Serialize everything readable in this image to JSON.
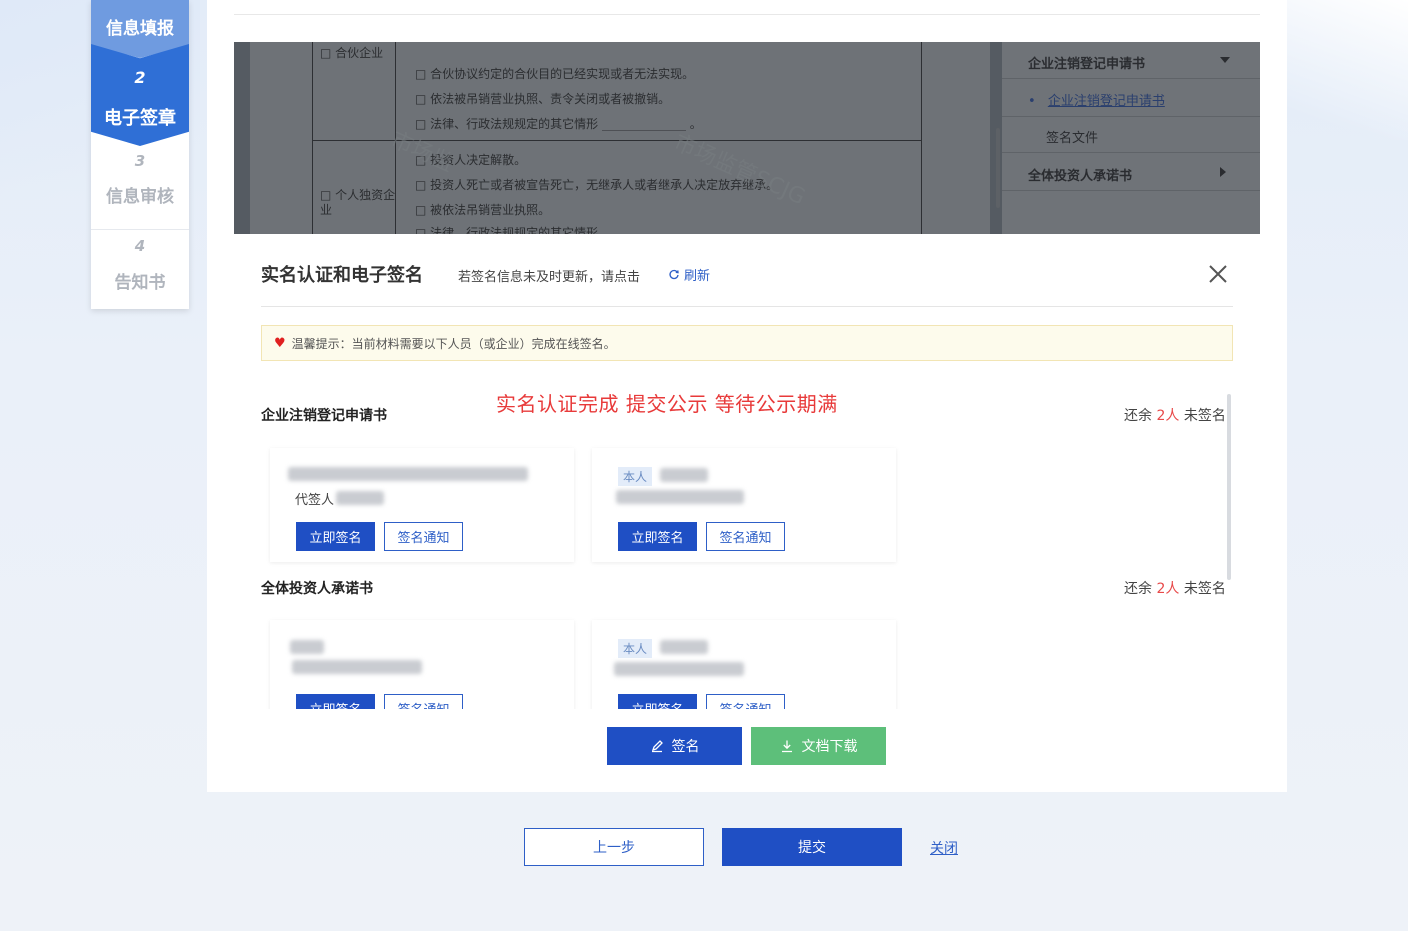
{
  "steps": [
    {
      "num": "",
      "label": "信息填报"
    },
    {
      "num": "2",
      "label": "电子签章"
    },
    {
      "num": "3",
      "label": "信息审核"
    },
    {
      "num": "4",
      "label": "告知书"
    }
  ],
  "doc_preview": {
    "left_label": "□ 个人独资企业",
    "top_fragment": "□ 合伙企业",
    "lines": [
      "□ 合伙协议约定的合伙目的已经实现或者无法实现。",
      "□ 依法被吊销营业执照、责令关闭或者被撤销。",
      "□ 法律、行政法规规定的其它情形 ______________ 。",
      "□ 投资人决定解散。",
      "□ 投资人死亡或者被宣告死亡，无继承人或者继承人决定放弃继承。",
      "□ 被依法吊销营业执照。",
      "□ 法律、行政法规规定的其它情形"
    ],
    "watermark_1": "市场监",
    "watermark_2": "市场监管SCJG",
    "nav": {
      "head_1": "企业注销登记申请书",
      "item_1": "企业注销登记申请书",
      "item_2": "签名文件",
      "head_2": "全体投资人承诺书"
    }
  },
  "modal": {
    "title": "实名认证和电子签名",
    "hint": "若签名信息未及时更新，请点击",
    "refresh": "刷新",
    "tip": "温馨提示：当前材料需要以下人员（或企业）完成在线签名。",
    "red_note": "实名认证完成  提交公示  等待公示期满",
    "sections": [
      {
        "title": "企业注销登记申请书",
        "remain_prefix": "还余",
        "remain_count": "2人",
        "remain_suffix": "未签名",
        "cards": [
          {
            "agent_label": "代签人",
            "tag": "",
            "sign_now": "立即签名",
            "notify": "签名通知"
          },
          {
            "agent_label": "",
            "tag": "本人",
            "sign_now": "立即签名",
            "notify": "签名通知"
          }
        ]
      },
      {
        "title": "全体投资人承诺书",
        "remain_prefix": "还余",
        "remain_count": "2人",
        "remain_suffix": "未签名",
        "cards": [
          {
            "agent_label": "",
            "tag": "",
            "sign_now": "立即签名",
            "notify": "签名通知"
          },
          {
            "agent_label": "",
            "tag": "本人",
            "sign_now": "立即签名",
            "notify": "签名通知"
          }
        ]
      }
    ],
    "btn_sign": "签名",
    "btn_download": "文档下载"
  },
  "actions": {
    "prev": "上一步",
    "submit": "提交",
    "close": "关闭"
  },
  "colors": {
    "primary": "#1f4fc4",
    "success": "#5dbf7a",
    "warning_text": "#e83a3a",
    "step_active": "#2f6fd6"
  }
}
